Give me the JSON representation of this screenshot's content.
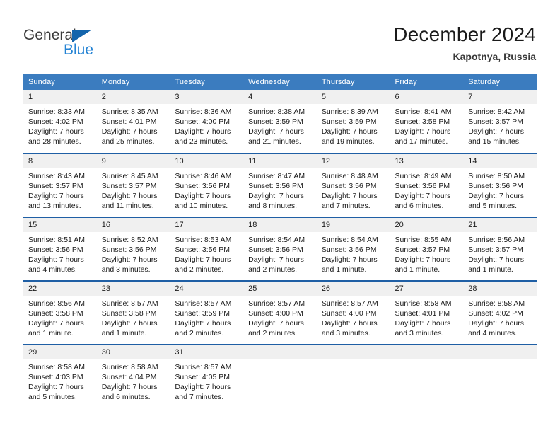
{
  "brand": {
    "name_top": "General",
    "name_bottom": "Blue",
    "color_dark": "#3b3b3b",
    "color_blue": "#2483d4",
    "triangle_color": "#1465ac"
  },
  "header": {
    "title": "December 2024",
    "subtitle": "Kapotnya, Russia"
  },
  "theme": {
    "header_bg": "#3b7cbf",
    "row_divider": "#1f5fa5",
    "daynum_bg": "#f0f0f0",
    "text": "#1a1a1a"
  },
  "weekdays": [
    "Sunday",
    "Monday",
    "Tuesday",
    "Wednesday",
    "Thursday",
    "Friday",
    "Saturday"
  ],
  "weeks": [
    [
      {
        "day": "1",
        "sunrise": "Sunrise: 8:33 AM",
        "sunset": "Sunset: 4:02 PM",
        "daylight1": "Daylight: 7 hours",
        "daylight2": "and 28 minutes."
      },
      {
        "day": "2",
        "sunrise": "Sunrise: 8:35 AM",
        "sunset": "Sunset: 4:01 PM",
        "daylight1": "Daylight: 7 hours",
        "daylight2": "and 25 minutes."
      },
      {
        "day": "3",
        "sunrise": "Sunrise: 8:36 AM",
        "sunset": "Sunset: 4:00 PM",
        "daylight1": "Daylight: 7 hours",
        "daylight2": "and 23 minutes."
      },
      {
        "day": "4",
        "sunrise": "Sunrise: 8:38 AM",
        "sunset": "Sunset: 3:59 PM",
        "daylight1": "Daylight: 7 hours",
        "daylight2": "and 21 minutes."
      },
      {
        "day": "5",
        "sunrise": "Sunrise: 8:39 AM",
        "sunset": "Sunset: 3:59 PM",
        "daylight1": "Daylight: 7 hours",
        "daylight2": "and 19 minutes."
      },
      {
        "day": "6",
        "sunrise": "Sunrise: 8:41 AM",
        "sunset": "Sunset: 3:58 PM",
        "daylight1": "Daylight: 7 hours",
        "daylight2": "and 17 minutes."
      },
      {
        "day": "7",
        "sunrise": "Sunrise: 8:42 AM",
        "sunset": "Sunset: 3:57 PM",
        "daylight1": "Daylight: 7 hours",
        "daylight2": "and 15 minutes."
      }
    ],
    [
      {
        "day": "8",
        "sunrise": "Sunrise: 8:43 AM",
        "sunset": "Sunset: 3:57 PM",
        "daylight1": "Daylight: 7 hours",
        "daylight2": "and 13 minutes."
      },
      {
        "day": "9",
        "sunrise": "Sunrise: 8:45 AM",
        "sunset": "Sunset: 3:57 PM",
        "daylight1": "Daylight: 7 hours",
        "daylight2": "and 11 minutes."
      },
      {
        "day": "10",
        "sunrise": "Sunrise: 8:46 AM",
        "sunset": "Sunset: 3:56 PM",
        "daylight1": "Daylight: 7 hours",
        "daylight2": "and 10 minutes."
      },
      {
        "day": "11",
        "sunrise": "Sunrise: 8:47 AM",
        "sunset": "Sunset: 3:56 PM",
        "daylight1": "Daylight: 7 hours",
        "daylight2": "and 8 minutes."
      },
      {
        "day": "12",
        "sunrise": "Sunrise: 8:48 AM",
        "sunset": "Sunset: 3:56 PM",
        "daylight1": "Daylight: 7 hours",
        "daylight2": "and 7 minutes."
      },
      {
        "day": "13",
        "sunrise": "Sunrise: 8:49 AM",
        "sunset": "Sunset: 3:56 PM",
        "daylight1": "Daylight: 7 hours",
        "daylight2": "and 6 minutes."
      },
      {
        "day": "14",
        "sunrise": "Sunrise: 8:50 AM",
        "sunset": "Sunset: 3:56 PM",
        "daylight1": "Daylight: 7 hours",
        "daylight2": "and 5 minutes."
      }
    ],
    [
      {
        "day": "15",
        "sunrise": "Sunrise: 8:51 AM",
        "sunset": "Sunset: 3:56 PM",
        "daylight1": "Daylight: 7 hours",
        "daylight2": "and 4 minutes."
      },
      {
        "day": "16",
        "sunrise": "Sunrise: 8:52 AM",
        "sunset": "Sunset: 3:56 PM",
        "daylight1": "Daylight: 7 hours",
        "daylight2": "and 3 minutes."
      },
      {
        "day": "17",
        "sunrise": "Sunrise: 8:53 AM",
        "sunset": "Sunset: 3:56 PM",
        "daylight1": "Daylight: 7 hours",
        "daylight2": "and 2 minutes."
      },
      {
        "day": "18",
        "sunrise": "Sunrise: 8:54 AM",
        "sunset": "Sunset: 3:56 PM",
        "daylight1": "Daylight: 7 hours",
        "daylight2": "and 2 minutes."
      },
      {
        "day": "19",
        "sunrise": "Sunrise: 8:54 AM",
        "sunset": "Sunset: 3:56 PM",
        "daylight1": "Daylight: 7 hours",
        "daylight2": "and 1 minute."
      },
      {
        "day": "20",
        "sunrise": "Sunrise: 8:55 AM",
        "sunset": "Sunset: 3:57 PM",
        "daylight1": "Daylight: 7 hours",
        "daylight2": "and 1 minute."
      },
      {
        "day": "21",
        "sunrise": "Sunrise: 8:56 AM",
        "sunset": "Sunset: 3:57 PM",
        "daylight1": "Daylight: 7 hours",
        "daylight2": "and 1 minute."
      }
    ],
    [
      {
        "day": "22",
        "sunrise": "Sunrise: 8:56 AM",
        "sunset": "Sunset: 3:58 PM",
        "daylight1": "Daylight: 7 hours",
        "daylight2": "and 1 minute."
      },
      {
        "day": "23",
        "sunrise": "Sunrise: 8:57 AM",
        "sunset": "Sunset: 3:58 PM",
        "daylight1": "Daylight: 7 hours",
        "daylight2": "and 1 minute."
      },
      {
        "day": "24",
        "sunrise": "Sunrise: 8:57 AM",
        "sunset": "Sunset: 3:59 PM",
        "daylight1": "Daylight: 7 hours",
        "daylight2": "and 2 minutes."
      },
      {
        "day": "25",
        "sunrise": "Sunrise: 8:57 AM",
        "sunset": "Sunset: 4:00 PM",
        "daylight1": "Daylight: 7 hours",
        "daylight2": "and 2 minutes."
      },
      {
        "day": "26",
        "sunrise": "Sunrise: 8:57 AM",
        "sunset": "Sunset: 4:00 PM",
        "daylight1": "Daylight: 7 hours",
        "daylight2": "and 3 minutes."
      },
      {
        "day": "27",
        "sunrise": "Sunrise: 8:58 AM",
        "sunset": "Sunset: 4:01 PM",
        "daylight1": "Daylight: 7 hours",
        "daylight2": "and 3 minutes."
      },
      {
        "day": "28",
        "sunrise": "Sunrise: 8:58 AM",
        "sunset": "Sunset: 4:02 PM",
        "daylight1": "Daylight: 7 hours",
        "daylight2": "and 4 minutes."
      }
    ],
    [
      {
        "day": "29",
        "sunrise": "Sunrise: 8:58 AM",
        "sunset": "Sunset: 4:03 PM",
        "daylight1": "Daylight: 7 hours",
        "daylight2": "and 5 minutes."
      },
      {
        "day": "30",
        "sunrise": "Sunrise: 8:58 AM",
        "sunset": "Sunset: 4:04 PM",
        "daylight1": "Daylight: 7 hours",
        "daylight2": "and 6 minutes."
      },
      {
        "day": "31",
        "sunrise": "Sunrise: 8:57 AM",
        "sunset": "Sunset: 4:05 PM",
        "daylight1": "Daylight: 7 hours",
        "daylight2": "and 7 minutes."
      },
      {
        "day": "",
        "sunrise": "",
        "sunset": "",
        "daylight1": "",
        "daylight2": ""
      },
      {
        "day": "",
        "sunrise": "",
        "sunset": "",
        "daylight1": "",
        "daylight2": ""
      },
      {
        "day": "",
        "sunrise": "",
        "sunset": "",
        "daylight1": "",
        "daylight2": ""
      },
      {
        "day": "",
        "sunrise": "",
        "sunset": "",
        "daylight1": "",
        "daylight2": ""
      }
    ]
  ]
}
